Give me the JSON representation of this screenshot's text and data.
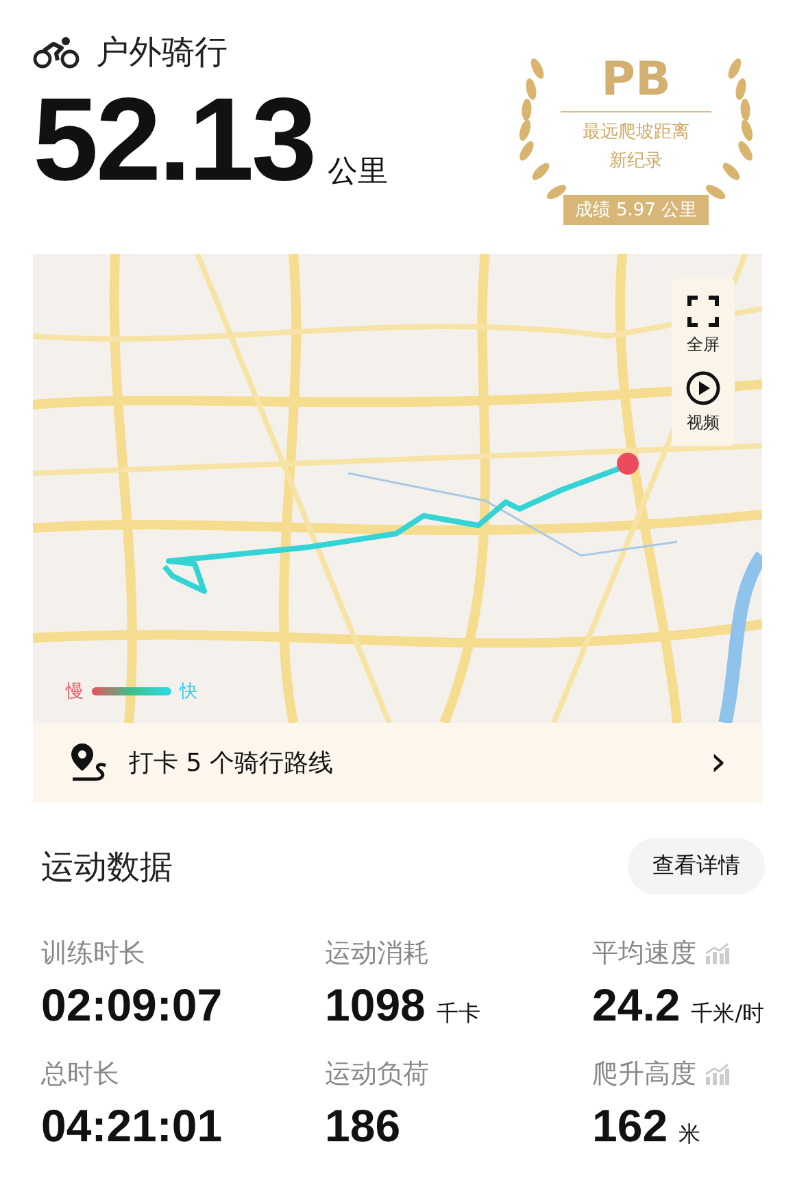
{
  "header": {
    "title": "户外骑行",
    "distance": "52.13",
    "unit": "公里"
  },
  "pb_badge": {
    "label": "PB",
    "subtitle_lines": [
      "最远爬坡距离",
      "新纪录"
    ],
    "result": "成绩 5.97 公里"
  },
  "map": {
    "buttons": [
      {
        "kind": "fullscreen",
        "label": "全屏"
      },
      {
        "kind": "video",
        "label": "视频"
      }
    ],
    "legend": {
      "slow": "慢",
      "fast": "快"
    }
  },
  "route_bar": {
    "text": "打卡 5 个骑行路线",
    "chevron": "›"
  },
  "stats": {
    "title": "运动数据",
    "details_button": "查看详情",
    "items": [
      {
        "label": "训练时长",
        "value": "02:09:07",
        "trend": false
      },
      {
        "label": "运动消耗",
        "value": "1098",
        "unit": "千卡",
        "trend": false
      },
      {
        "label": "平均速度",
        "value": "24.2",
        "unit": "千米/时",
        "trend": true
      },
      {
        "label": "总时长",
        "value": "04:21:01",
        "trend": false
      },
      {
        "label": "运动负荷",
        "value": "186",
        "trend": false
      },
      {
        "label": "爬升高度",
        "value": "162",
        "unit": "米",
        "trend": true
      }
    ]
  }
}
